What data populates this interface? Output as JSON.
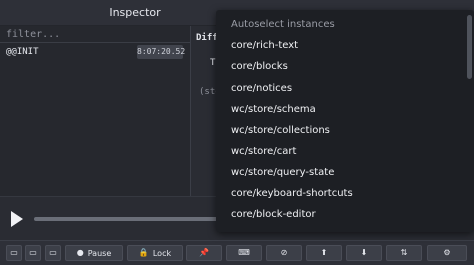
{
  "window": {
    "title": "Inspector"
  },
  "left": {
    "filter_placeholder": "filter...",
    "actions": [
      {
        "name": "@@INIT",
        "time": "8:07:20.52"
      }
    ]
  },
  "right": {
    "tab_partial": "Diff",
    "sub_partial": "T",
    "code_partial": "(sto"
  },
  "dropdown": {
    "header": "Autoselect instances",
    "items": [
      "core/rich-text",
      "core/blocks",
      "core/notices",
      "wc/store/schema",
      "wc/store/collections",
      "wc/store/cart",
      "wc/store/query-state",
      "core/keyboard-shortcuts",
      "core/block-editor"
    ]
  },
  "toolbar": {
    "pause_label": "Pause",
    "lock_label": "Lock"
  },
  "icons": {
    "play": "play-icon",
    "layout": "layout-icon",
    "pause": "pause-icon",
    "lock": "lock-icon",
    "pin": "pin-icon",
    "keyboard": "keyboard-icon",
    "persist": "persist-icon",
    "upload": "upload-icon",
    "download": "download-icon",
    "remote": "remote-icon",
    "settings": "gear-icon"
  }
}
